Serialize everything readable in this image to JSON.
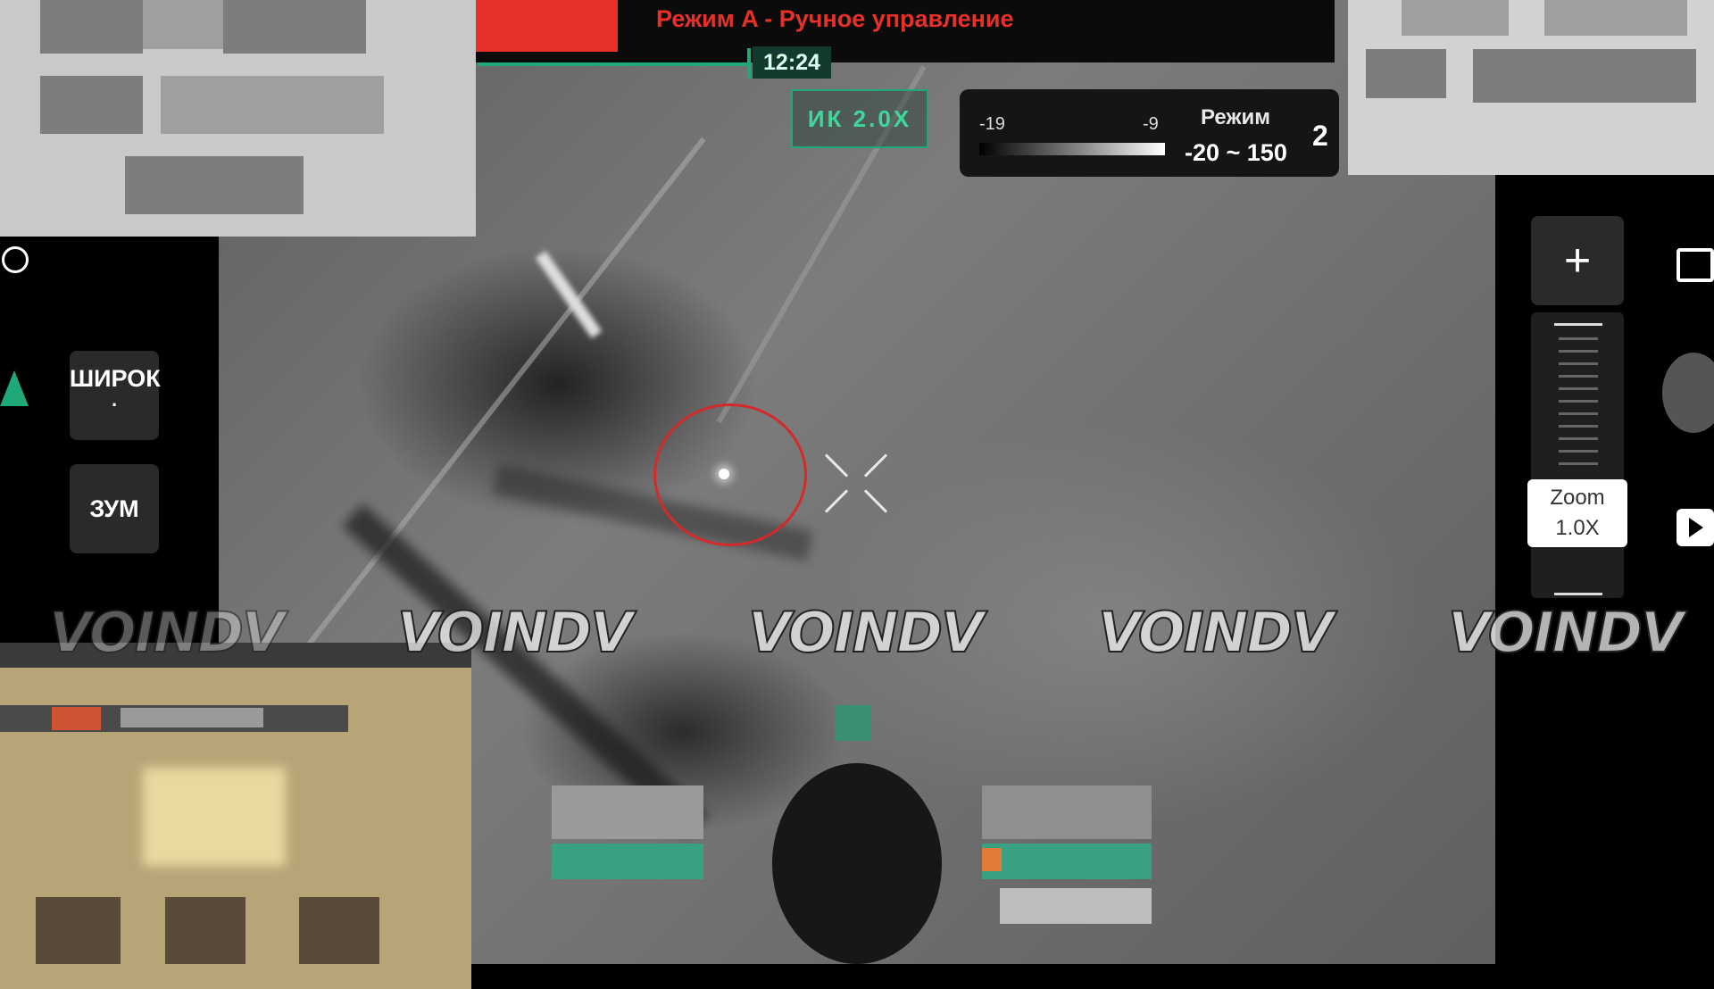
{
  "header": {
    "mode_title": "Режим A - Ручное управление",
    "time": "12:24"
  },
  "camera": {
    "ir_zoom_badge": "ИК 2.0X"
  },
  "thermal": {
    "min_label": "-19",
    "max_label": "-9",
    "mode_label": "Режим",
    "range": "-20 ~ 150",
    "mode_number": "2"
  },
  "left_controls": {
    "wide_label": "ШИРОК",
    "wide_dot": ".",
    "zoom_label": "ЗУМ"
  },
  "right_controls": {
    "zoom_plus": "+",
    "zoom_title": "Zoom",
    "zoom_value": "1.0X"
  },
  "watermark": {
    "text": "VOINDV"
  },
  "icons": [
    "compass-icon",
    "nav-arrow-icon",
    "crosshair-icon",
    "photo-mode-icon",
    "play-icon",
    "zoom-plus-icon"
  ],
  "colors": {
    "accent_green": "#1fa878",
    "alert_red": "#e8302a",
    "target_red": "#d42a2a"
  }
}
